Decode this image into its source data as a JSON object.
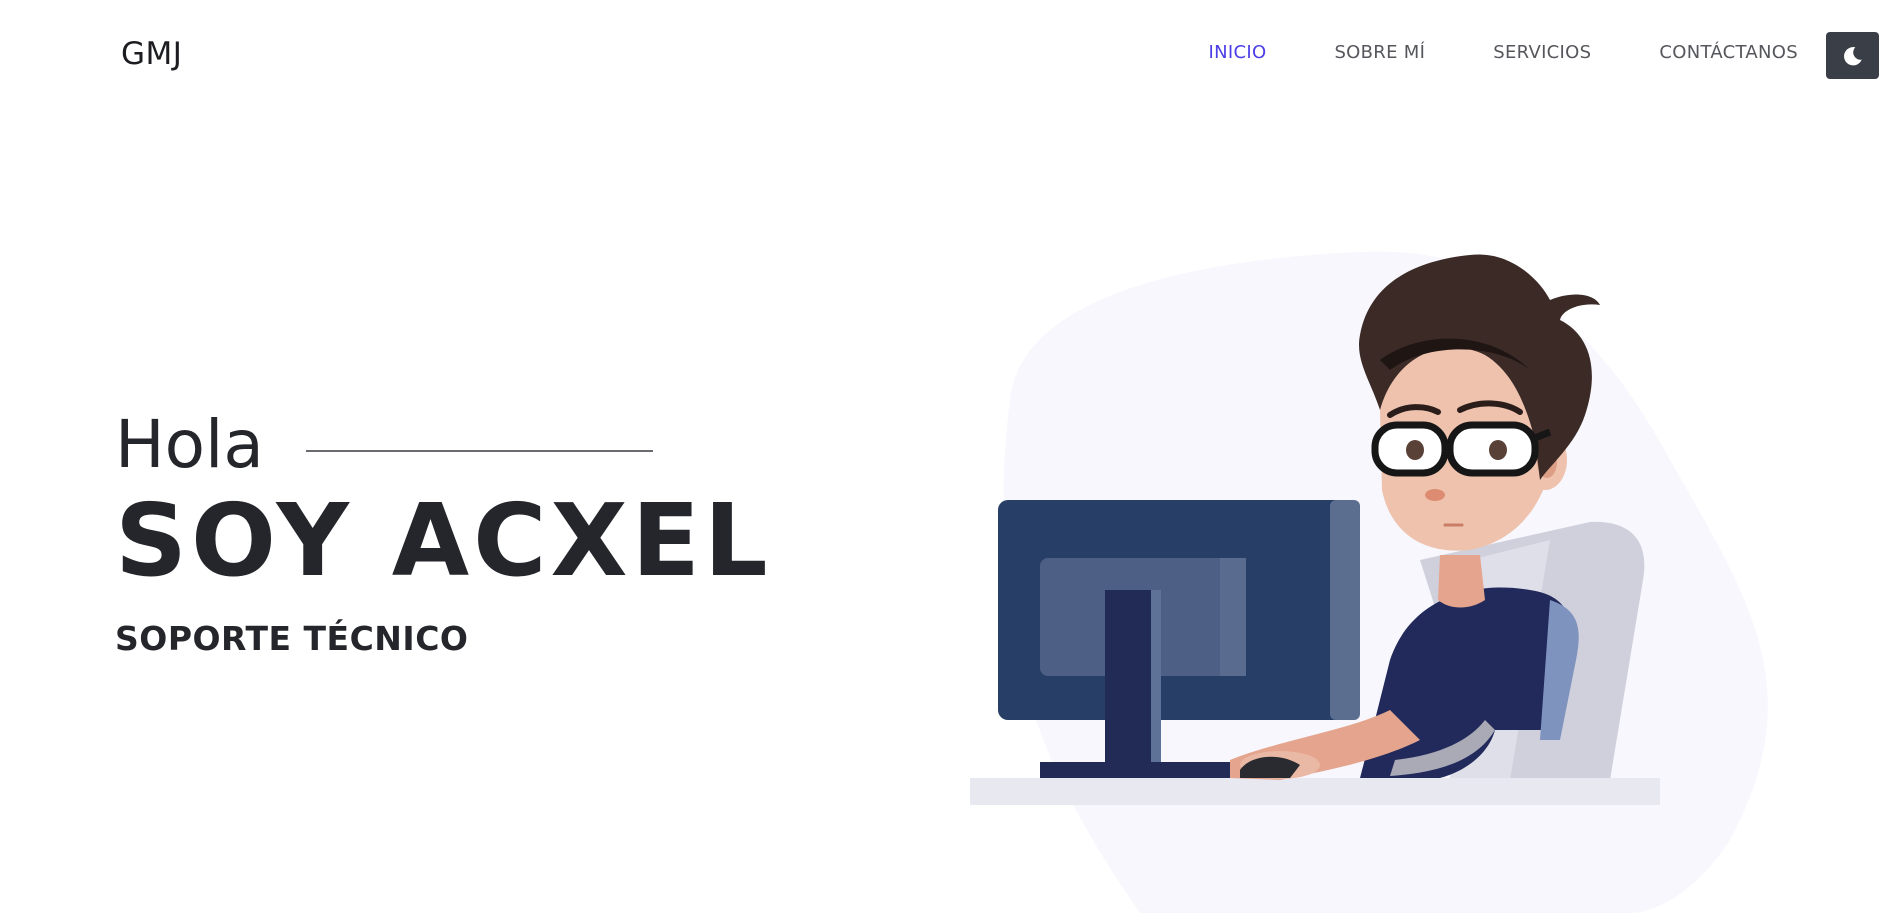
{
  "header": {
    "logo": "GMJ",
    "nav": [
      {
        "label": "INICIO",
        "active": true
      },
      {
        "label": "SOBRE MÍ",
        "active": false
      },
      {
        "label": "SERVICIOS",
        "active": false
      },
      {
        "label": "CONTÁCTANOS",
        "active": false
      }
    ],
    "theme_toggle_icon": "moon-icon"
  },
  "hero": {
    "greeting": "Hola",
    "name": "SOY ACXEL",
    "subtitle": "SOPORTE TÉCNICO"
  },
  "colors": {
    "accent": "#4d3fe6",
    "text": "#25262b",
    "toggle_bg": "#3a3f47",
    "blob": "#f7f7fd"
  }
}
